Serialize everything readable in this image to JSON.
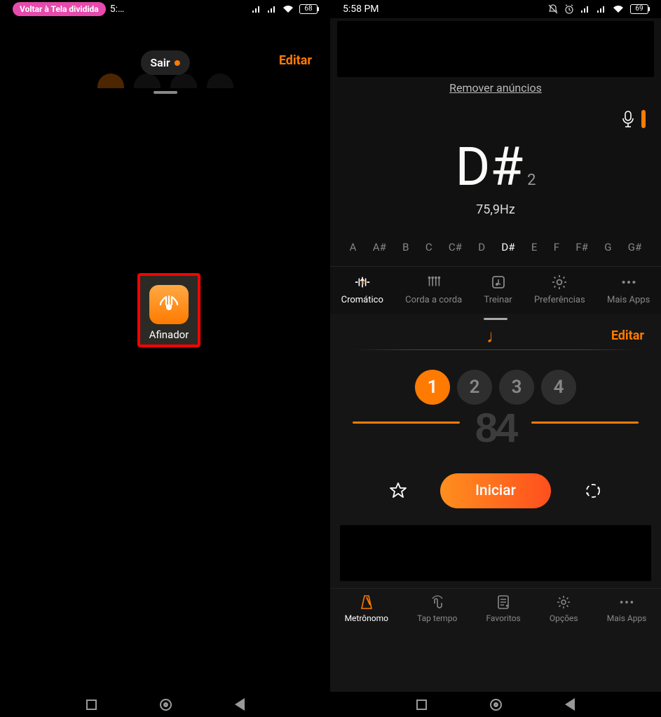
{
  "left": {
    "status": {
      "pill": "Voltar à Tela dividida",
      "time_trunc": "5:…",
      "battery": "68"
    },
    "sair": "Sair",
    "editar": "Editar",
    "app": {
      "label": "Afinador"
    }
  },
  "right": {
    "status": {
      "time": "5:58 PM",
      "battery": "69"
    },
    "remove_ads": "Remover anúncios",
    "note": {
      "name": "D#",
      "octave": "2",
      "freq": "75,9Hz"
    },
    "strip": [
      "A",
      "A#",
      "B",
      "C",
      "C#",
      "D",
      "D#",
      "E",
      "F",
      "F#",
      "G",
      "G#"
    ],
    "strip_active": "D#",
    "tuner_tabs": [
      {
        "key": "cromatic",
        "label": "Cromático"
      },
      {
        "key": "corda",
        "label": "Corda a corda"
      },
      {
        "key": "treinar",
        "label": "Treinar"
      },
      {
        "key": "pref",
        "label": "Preferências"
      },
      {
        "key": "mais",
        "label": "Mais Apps"
      }
    ],
    "metro": {
      "editar": "Editar",
      "beats": [
        "1",
        "2",
        "3",
        "4"
      ],
      "tempo": "84",
      "start": "Iniciar",
      "tabs": [
        {
          "key": "met",
          "label": "Metrônomo"
        },
        {
          "key": "tap",
          "label": "Tap tempo"
        },
        {
          "key": "fav",
          "label": "Favoritos"
        },
        {
          "key": "opc",
          "label": "Opções"
        },
        {
          "key": "mais",
          "label": "Mais Apps"
        }
      ]
    }
  }
}
